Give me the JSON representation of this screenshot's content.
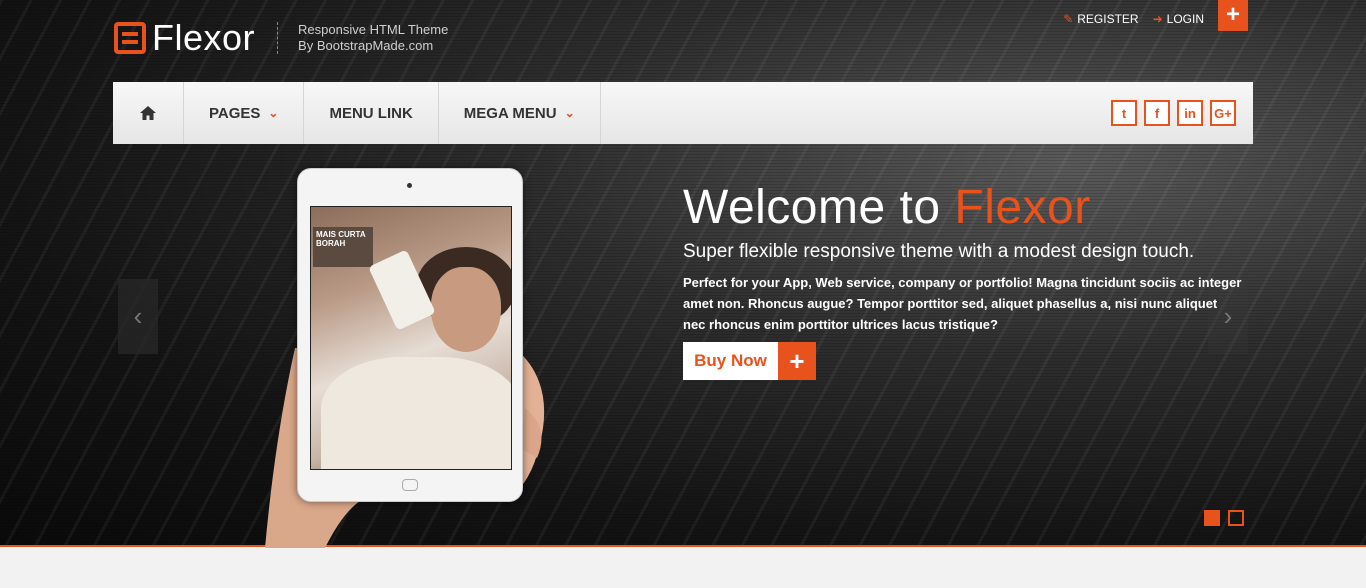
{
  "brand": {
    "name": "Flexor",
    "tagline_line1": "Responsive HTML Theme",
    "tagline_line2": "By BootstrapMade.com",
    "accent_color": "#e8521d"
  },
  "top_links": [
    {
      "label": "REGISTER",
      "icon": "edit-icon"
    },
    {
      "label": "LOGIN",
      "icon": "sign-in-icon"
    }
  ],
  "top_plus": {
    "label": "+",
    "icon": "plus-icon"
  },
  "nav": {
    "home_icon": "home-icon",
    "items": [
      {
        "label": "PAGES",
        "has_dropdown": true
      },
      {
        "label": "MENU LINK",
        "has_dropdown": false
      },
      {
        "label": "MEGA MENU",
        "has_dropdown": true
      }
    ],
    "chevron": "⌄",
    "socials": [
      {
        "name": "twitter",
        "glyph": "t"
      },
      {
        "name": "facebook",
        "glyph": "f"
      },
      {
        "name": "linkedin",
        "glyph": "in"
      },
      {
        "name": "google-plus",
        "glyph": "G+"
      }
    ]
  },
  "slider": {
    "prev_arrow": "‹",
    "next_arrow": "›",
    "screen_sign": "MAIS CURTA BORAH",
    "title_prefix": "Welcome to ",
    "title_accent": "Flexor",
    "subtitle": "Super flexible responsive theme with a modest design touch.",
    "body": "Perfect for your App, Web service, company or portfolio! Magna tincidunt sociis ac integer amet non. Rhoncus augue? Tempor porttitor sed, aliquet phasellus a, nisi nunc aliquet nec rhoncus enim porttitor ultrices lacus tristique?",
    "cta_label": "Buy Now",
    "cta_plus": "+",
    "dots": [
      true,
      false
    ]
  }
}
